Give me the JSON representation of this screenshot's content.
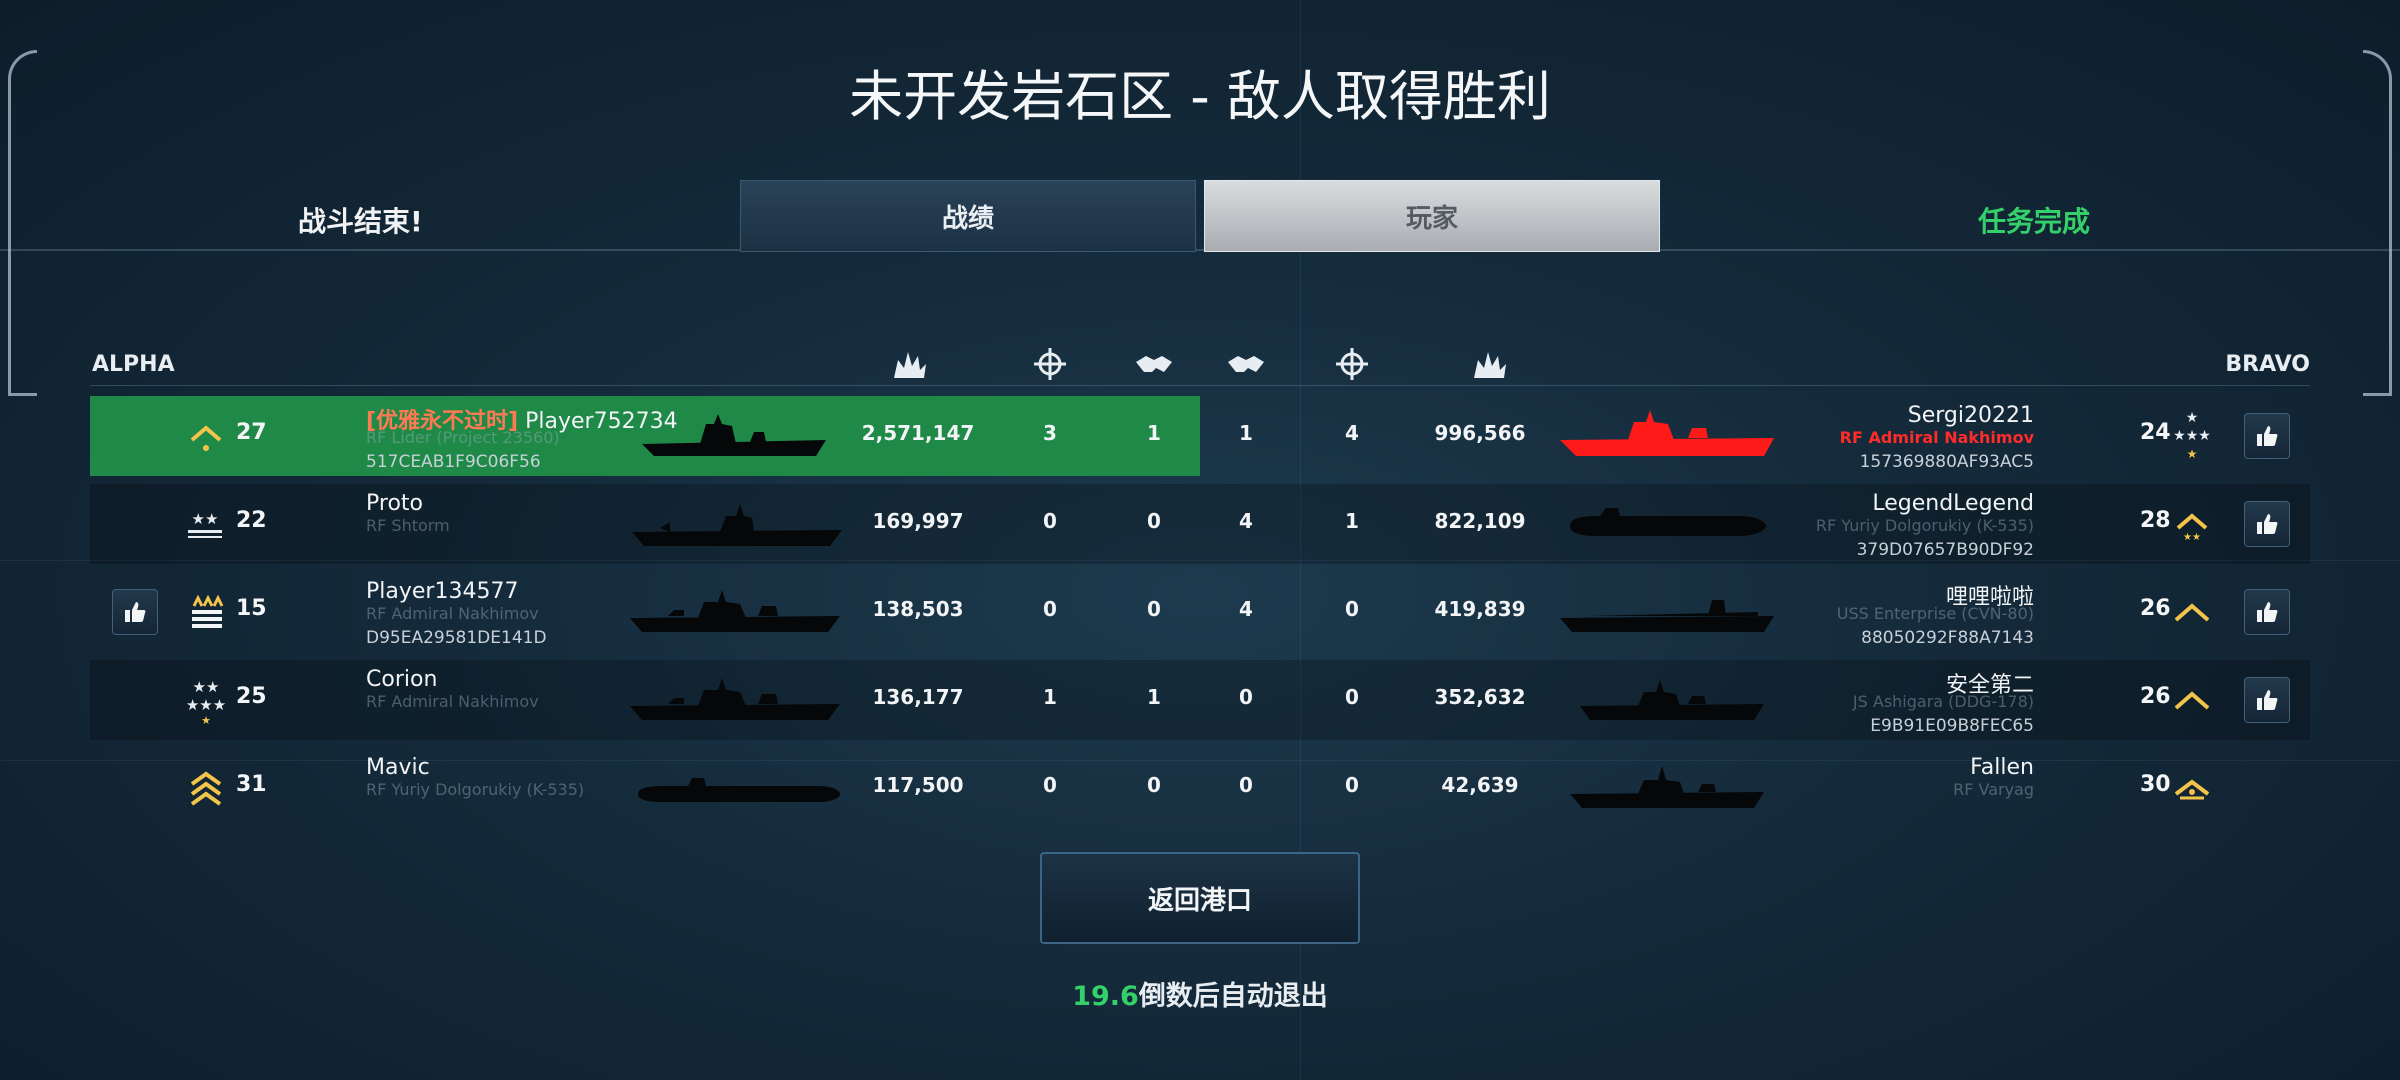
{
  "header": {
    "title": "未开发岩石区 - 敌人取得胜利",
    "battle_over": "战斗结束!",
    "mission_complete": "任务完成"
  },
  "tabs": [
    {
      "label": "战绩",
      "active": false
    },
    {
      "label": "玩家",
      "active": true
    }
  ],
  "teams": {
    "left": "ALPHA",
    "right": "BRAVO"
  },
  "columns_icons": [
    "damage-icon",
    "kills-icon",
    "assists-icon",
    "assists-icon",
    "kills-icon",
    "damage-icon"
  ],
  "alpha": [
    {
      "clan": "[优雅永不过时]",
      "name": "Player752734",
      "ship": "RF Lider (Project 23560)",
      "id": "517CEAB1F9C06F56",
      "level": "27",
      "rank_icon": "chevron-rank-icon",
      "damage": "2,571,147",
      "kills": "3",
      "assists": "1",
      "highlight": true,
      "liked": false
    },
    {
      "clan": "",
      "name": "Proto",
      "ship": "RF Shtorm",
      "id": "",
      "level": "22",
      "rank_icon": "two-stars-rank-icon",
      "damage": "169,997",
      "kills": "0",
      "assists": "0",
      "highlight": false,
      "liked": false
    },
    {
      "clan": "",
      "name": "Player134577",
      "ship": "RF Admiral Nakhimov",
      "id": "D95EA29581DE141D",
      "level": "15",
      "rank_icon": "bars-rank-icon",
      "damage": "138,503",
      "kills": "0",
      "assists": "0",
      "highlight": false,
      "liked": true
    },
    {
      "clan": "",
      "name": "Corion",
      "ship": "RF Admiral Nakhimov",
      "id": "",
      "level": "25",
      "rank_icon": "stars-rank-icon",
      "damage": "136,177",
      "kills": "1",
      "assists": "1",
      "highlight": false,
      "liked": false
    },
    {
      "clan": "",
      "name": "Mavic",
      "ship": "RF Yuriy Dolgorukiy (K-535)",
      "id": "",
      "level": "31",
      "rank_icon": "double-chevron-rank-icon",
      "damage": "117,500",
      "kills": "0",
      "assists": "0",
      "highlight": false,
      "liked": false
    }
  ],
  "bravo": [
    {
      "name": "Sergi20221",
      "ship": "RF Admiral Nakhimov",
      "id": "157369880AF93AC5",
      "level": "24",
      "rank_icon": "stars-rank-icon",
      "assists": "1",
      "kills": "4",
      "damage": "996,566",
      "enemy_highlight": true,
      "like_button": true
    },
    {
      "name": "LegendLegend",
      "ship": "RF Yuriy Dolgorukiy (K-535)",
      "id": "379D07657B90DF92",
      "level": "28",
      "rank_icon": "chevron-rank-icon",
      "assists": "4",
      "kills": "1",
      "damage": "822,109",
      "enemy_highlight": false,
      "like_button": true
    },
    {
      "name": "哩哩啦啦",
      "ship": "USS Enterprise (CVN-80)",
      "id": "88050292F88A7143",
      "level": "26",
      "rank_icon": "chevron-rank-icon",
      "assists": "4",
      "kills": "0",
      "damage": "419,839",
      "enemy_highlight": false,
      "like_button": true
    },
    {
      "name": "安全第二",
      "ship": "JS Ashigara (DDG-178)",
      "id": "E9B91E09B8FEC65",
      "level": "26",
      "rank_icon": "chevron-rank-icon",
      "assists": "0",
      "kills": "0",
      "damage": "352,632",
      "enemy_highlight": false,
      "like_button": true
    },
    {
      "name": "Fallen",
      "ship": "RF Varyag",
      "id": "",
      "level": "30",
      "rank_icon": "chevron-rank-icon",
      "assists": "0",
      "kills": "0",
      "damage": "42,639",
      "enemy_highlight": false,
      "like_button": false
    }
  ],
  "footer": {
    "return_label": "返回港口",
    "countdown_value": "19.6",
    "countdown_text": "倒数后自动退出"
  },
  "colors": {
    "highlight_green": "#1f8a47",
    "enemy_red": "#ff2a2a",
    "countdown_green": "#34d06a",
    "clan_orange": "#ff7a52"
  }
}
